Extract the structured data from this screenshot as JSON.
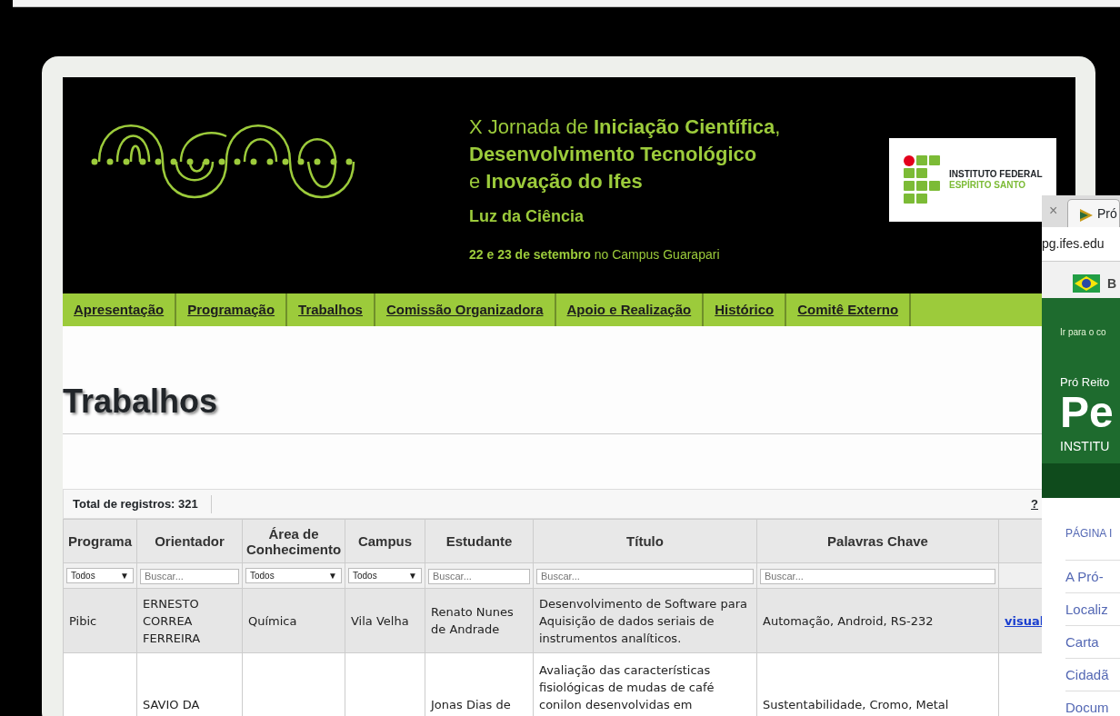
{
  "header": {
    "title_lines": [
      "X Jornada de **Iniciação Científica**,",
      "**Desenvolvimento Tecnológico**",
      "e **Inovação do Ifes**"
    ],
    "subtitle": "Luz da Ciência",
    "date": "**22 e 23 de setembro** no Campus Guarapari",
    "logo": {
      "line1": "INSTITUTO FEDERAL",
      "line2": "ESPÍRITO SANTO"
    }
  },
  "nav": [
    "Apresentação",
    "Programação",
    "Trabalhos",
    "Comissão Organizadora",
    "Apoio e Realização",
    "Histórico",
    "Comitê Externo"
  ],
  "page_title": "Trabalhos",
  "table": {
    "total": "Total de registros: 321",
    "help": "?",
    "columns": [
      "Programa",
      "Orientador",
      "Área de Conhecimento",
      "Campus",
      "Estudante",
      "Título",
      "Palavras Chave"
    ],
    "filters": [
      {
        "kind": "select",
        "value": "Todos",
        "caret": "▼"
      },
      {
        "kind": "search",
        "placeholder": "Buscar..."
      },
      {
        "kind": "select",
        "value": "Todos",
        "caret": "▼"
      },
      {
        "kind": "select",
        "value": "Todos",
        "caret": "▼"
      },
      {
        "kind": "search",
        "placeholder": "Buscar..."
      },
      {
        "kind": "search",
        "placeholder": "Buscar..."
      },
      {
        "kind": "search",
        "placeholder": "Buscar..."
      }
    ],
    "rows": [
      {
        "cells": [
          "Pibic",
          "ERNESTO CORREA FERREIRA",
          "Química",
          "Vila Velha",
          "Renato Nunes de Andrade",
          "Desenvolvimento de Software para Aquisição de dados seriais de instrumentos analíticos.",
          "Automação, Android, RS-232"
        ],
        "link": "visual"
      },
      {
        "cells": [
          "",
          "SAVIO DA",
          "",
          "",
          "Jonas Dias de",
          "Avaliação das características fisiológicas de mudas de café conilon desenvolvidas em",
          "Sustentabilidade, Cromo, Metal"
        ]
      }
    ]
  },
  "other_window": {
    "close": "×",
    "tab": "Pró",
    "address": "pg.ifes.edu",
    "gov_bar": "B",
    "skip_link": "Ir para o co",
    "kicker": "Pró Reito",
    "big_title": "Pe",
    "institute": "INSTITU",
    "menu_heading": "PÁGINA I",
    "menu": [
      "A Pró-",
      "Localiz",
      "Carta",
      "Cidadã",
      "Docum"
    ]
  }
}
